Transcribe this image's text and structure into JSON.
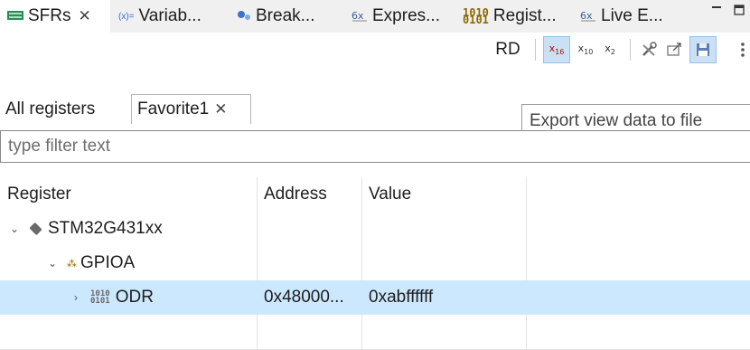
{
  "view_tabs": [
    {
      "label": "SFRs",
      "icon": "sfr-icon",
      "closable": true,
      "active": true
    },
    {
      "label": "Variab...",
      "icon": "variables-icon"
    },
    {
      "label": "Break...",
      "icon": "breakpoints-icon"
    },
    {
      "label": "Expres...",
      "icon": "expressions-icon"
    },
    {
      "label": "Regist...",
      "icon": "registers-icon"
    },
    {
      "label": "Live E...",
      "icon": "live-expressions-icon"
    }
  ],
  "tab_close_glyph": "✕",
  "toolbar": {
    "rd_label": "RD",
    "hex_label": "x16",
    "dec_label": "x10",
    "bin_label": "x2"
  },
  "subtabs": [
    {
      "label": "All registers"
    },
    {
      "label": "Favorite1",
      "closable": true,
      "active": true
    }
  ],
  "tooltip": "Export view data to file",
  "filter": {
    "placeholder": "type filter text"
  },
  "columns": [
    "Register",
    "Address",
    "Value"
  ],
  "rows": [
    {
      "name": "STM32G431xx",
      "address": "",
      "value": "",
      "level": 0,
      "expanded": true,
      "icon": "chip-icon"
    },
    {
      "name": "GPIOA",
      "address": "",
      "value": "",
      "level": 1,
      "expanded": true,
      "icon": "peripheral-icon"
    },
    {
      "name": "ODR",
      "address": "0x48000...",
      "value": "0xabffffff",
      "level": 2,
      "expanded": false,
      "selected": true,
      "icon": "register-icon"
    }
  ],
  "colors": {
    "selection": "#cce8ff",
    "format_red": "#d10000"
  }
}
